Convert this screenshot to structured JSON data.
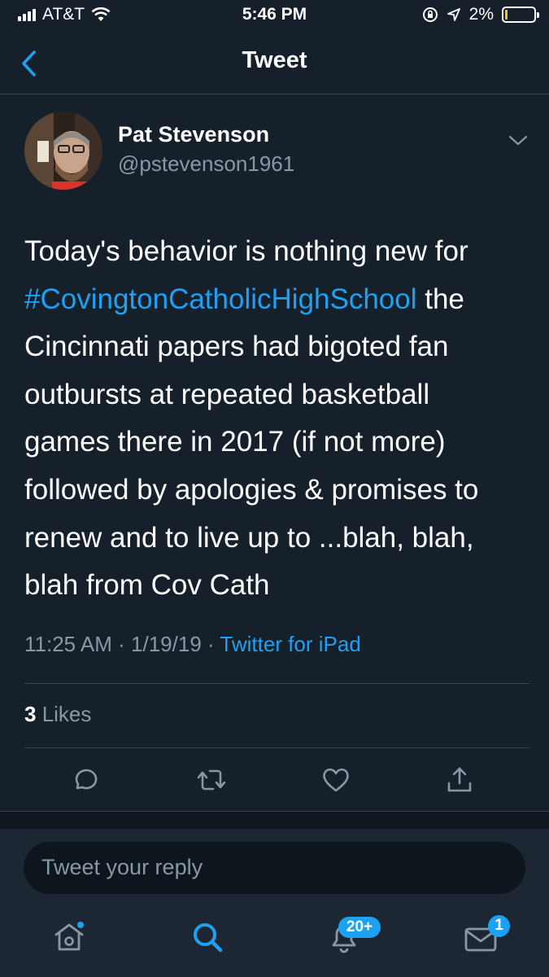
{
  "status_bar": {
    "carrier": "AT&T",
    "time": "5:46 PM",
    "battery_percent": "2%",
    "battery_level": 0.02
  },
  "header": {
    "title": "Tweet"
  },
  "tweet": {
    "author_name": "Pat Stevenson",
    "author_handle": "@pstevenson1961",
    "text_line_1": "Today's behavior is nothing new for",
    "hashtag": "#CovingtonCatholicHighSchool",
    "text_line_2_rest": " the",
    "text_line_3": "Cincinnati papers had bigoted fan",
    "text_line_4": "outbursts at repeated basketball",
    "text_line_5": "games there in 2017 (if not more)",
    "text_line_6": "followed by apologies & promises to",
    "text_line_7": "renew and to live up to ...blah, blah,",
    "text_line_8": "blah from Cov Cath",
    "timestamp": "11:25 AM · 1/19/19 · ",
    "source": "Twitter for iPad",
    "likes_count": "3",
    "likes_label": " Likes"
  },
  "reply": {
    "placeholder": "Tweet your reply"
  },
  "tab_bar": {
    "notifications_badge": "20+",
    "messages_badge": "1"
  },
  "icons": {
    "back": "chevron-left-icon",
    "caret": "chevron-down-icon",
    "reply": "comment-icon",
    "retweet": "retweet-icon",
    "like": "heart-icon",
    "share": "share-icon",
    "home": "home-icon",
    "search": "search-icon",
    "notifications": "bell-icon",
    "messages": "envelope-icon"
  },
  "colors": {
    "background": "#15202b",
    "accent": "#1da1f2",
    "secondary_text": "#8899a6",
    "divider": "#38444d"
  }
}
